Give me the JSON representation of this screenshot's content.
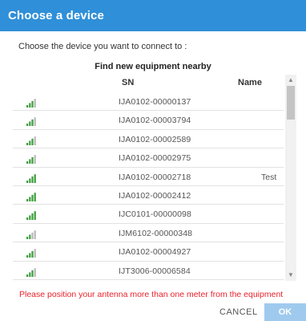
{
  "dialog": {
    "title": "Choose a device",
    "subtitle": "Choose the device you want to connect to :",
    "section_heading": "Find new equipment nearby",
    "columns": {
      "sn": "SN",
      "name": "Name"
    },
    "devices": [
      {
        "sn": "IJA0102-00000137",
        "name": "",
        "signal_level": 3
      },
      {
        "sn": "IJA0102-00003794",
        "name": "",
        "signal_level": 3
      },
      {
        "sn": "IJA0102-00002589",
        "name": "",
        "signal_level": 3
      },
      {
        "sn": "IJA0102-00002975",
        "name": "",
        "signal_level": 3
      },
      {
        "sn": "IJA0102-00002718",
        "name": "Test",
        "signal_level": 4
      },
      {
        "sn": "IJA0102-00002412",
        "name": "",
        "signal_level": 4
      },
      {
        "sn": "IJC0101-00000098",
        "name": "",
        "signal_level": 4
      },
      {
        "sn": "IJM6102-00000348",
        "name": "",
        "signal_level": 2
      },
      {
        "sn": "IJA0102-00004927",
        "name": "",
        "signal_level": 3
      },
      {
        "sn": "IJT3006-00006584",
        "name": "",
        "signal_level": 3
      }
    ],
    "warning": "Please position your antenna more than one meter from the equipment",
    "cancel_label": "CANCEL",
    "ok_label": "OK",
    "colors": {
      "accent": "#2f8fd8",
      "warning": "#e8232c",
      "signal": "#3a9e3a",
      "signal_off": "#b8b8b8",
      "ok_disabled": "#9fcaee"
    },
    "icons": {
      "signal": "signal-strength-icon",
      "scroll_up": "scroll-up-icon",
      "scroll_down": "scroll-down-icon"
    }
  }
}
